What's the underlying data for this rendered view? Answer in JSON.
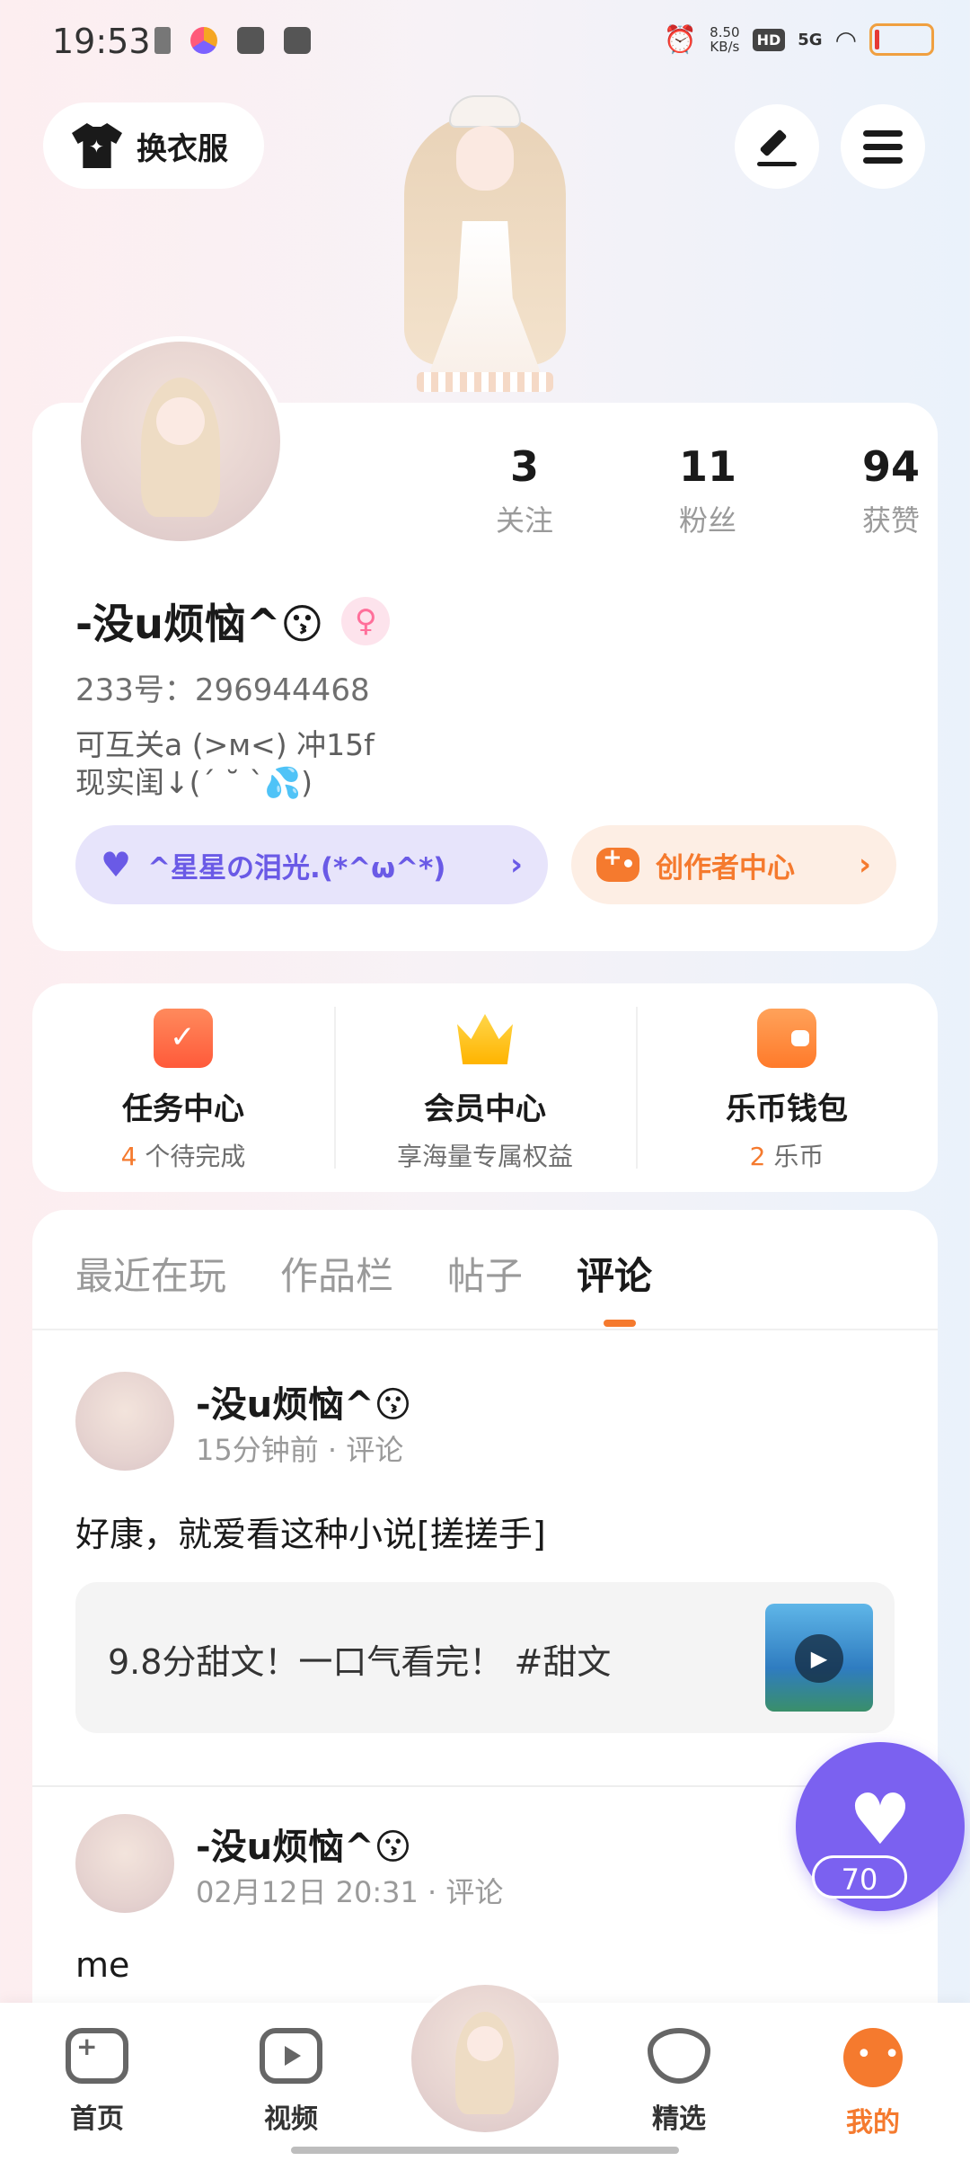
{
  "status_bar": {
    "time": "19:53",
    "speed": "8.50",
    "speed_unit": "KB/s",
    "hd": "HD",
    "network": "5G"
  },
  "top": {
    "dress_label": "换衣服"
  },
  "profile": {
    "stats": [
      {
        "value": "3",
        "label": "关注"
      },
      {
        "value": "11",
        "label": "粉丝"
      },
      {
        "value": "94",
        "label": "获赞"
      }
    ],
    "username": "-没u烦恼^😗",
    "gender_symbol": "♀",
    "uid": "233号：296944468",
    "bio": "可互关a (>ᴍ<) 冲15f\n现实闺↓(´ ˘ `💦)",
    "fan_group_label": "^星星の泪光.(*^ω^*)",
    "creator_label": "创作者中心"
  },
  "services": [
    {
      "title": "任务中心",
      "highlight": "4",
      "sub": " 个待完成",
      "icon": "calendar-check-icon"
    },
    {
      "title": "会员中心",
      "highlight": "",
      "sub": "享海量专属权益",
      "icon": "crown-icon"
    },
    {
      "title": "乐币钱包",
      "highlight": "2",
      "sub": " 乐币",
      "icon": "wallet-icon"
    }
  ],
  "feed": {
    "tabs": [
      "最近在玩",
      "作品栏",
      "帖子",
      "评论"
    ],
    "active_tab": "评论",
    "posts": [
      {
        "name": "-没u烦恼^😗",
        "meta": "15分钟前  ·  评论",
        "body": "好康，就爱看这种小说[搓搓手]",
        "quote": "9.8分甜文！一口气看完！    #甜文"
      },
      {
        "name": "-没u烦恼^😗",
        "meta": "02月12日 20:31  ·  评论",
        "body": "me"
      }
    ]
  },
  "fab": {
    "count": "70"
  },
  "bottom_nav": [
    {
      "label": "首页"
    },
    {
      "label": "视频"
    },
    {
      "label": "精选"
    },
    {
      "label": "我的",
      "active": true
    }
  ],
  "colors": {
    "accent_orange": "#f57a2e",
    "accent_purple": "#7b61f0"
  }
}
